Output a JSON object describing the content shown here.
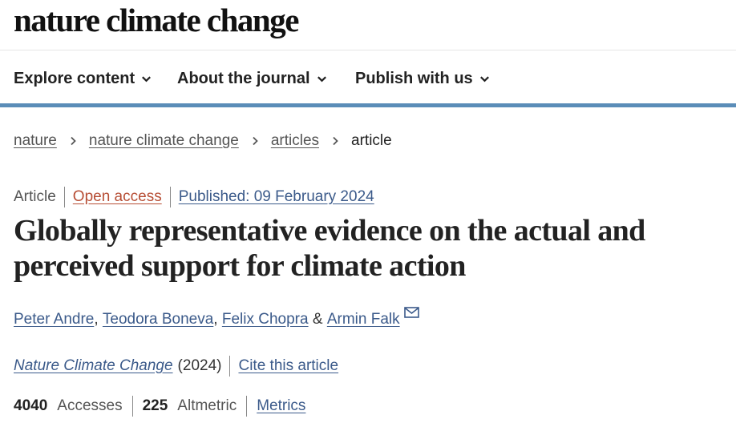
{
  "header": {
    "brand": "nature climate change"
  },
  "nav": {
    "items": [
      {
        "label": "Explore content"
      },
      {
        "label": "About the journal"
      },
      {
        "label": "Publish with us"
      }
    ]
  },
  "breadcrumb": {
    "items": [
      "nature",
      "nature climate change",
      "articles"
    ],
    "current": "article"
  },
  "article": {
    "type": "Article",
    "access": "Open access",
    "published": "Published: 09 February 2024",
    "title": "Globally representative evidence on the actual and perceived support for climate action",
    "authors": [
      "Peter Andre",
      "Teodora Boneva",
      "Felix Chopra",
      "Armin Falk"
    ],
    "author_separators": [
      ", ",
      ", ",
      " & "
    ],
    "journal": "Nature Climate Change",
    "year": "(2024)",
    "cite_label": "Cite this article",
    "accesses_count": "4040",
    "accesses_label": "Accesses",
    "altmetric_count": "225",
    "altmetric_label": "Altmetric",
    "metrics_label": "Metrics"
  },
  "colors": {
    "accent_bar": "#5b8db8",
    "link": "#3b5a8a",
    "open_access": "#b74e35"
  }
}
